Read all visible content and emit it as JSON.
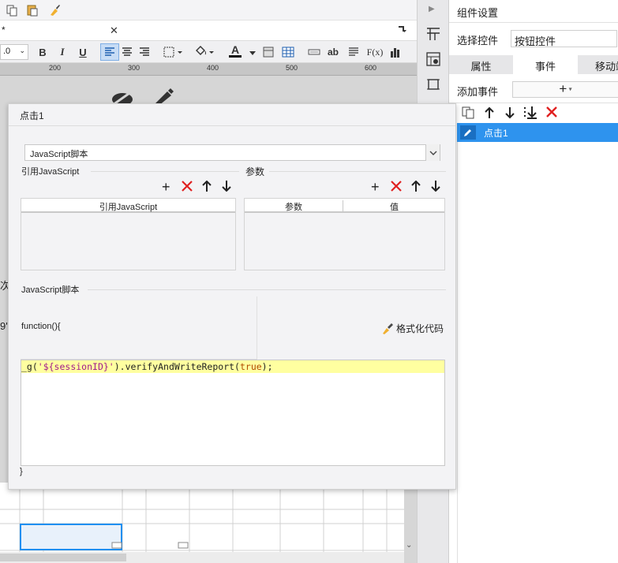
{
  "left": {
    "tab_label": "*",
    "close_glyph": "✕",
    "font_size": ".0",
    "format_buttons": {
      "bold": "B",
      "italic": "I",
      "underline": "U",
      "text_color": "A",
      "formula": "F(x)",
      "abc": "ab"
    },
    "ruler_ticks": [
      "200",
      "300",
      "400",
      "500",
      "600"
    ],
    "left_edge_glyphs": [
      "次",
      "9'"
    ]
  },
  "side_strip": {
    "collapse_glyph": "▶"
  },
  "panel": {
    "title": "组件设置",
    "select_control_label": "选择控件",
    "select_control_value": "按钮控件",
    "tabs": [
      "属性",
      "事件",
      "移动端"
    ],
    "add_event_label": "添加事件",
    "add_event_button": "+",
    "events": [
      {
        "label": "点击1",
        "selected": true
      }
    ]
  },
  "dialog": {
    "title": "点击1",
    "type_select_value": "JavaScript脚本",
    "ref_js": {
      "group_label": "引用JavaScript",
      "column_header": "引用JavaScript",
      "rows": []
    },
    "params": {
      "group_label": "参数",
      "column_headers": [
        "参数",
        "值"
      ],
      "rows": []
    },
    "script": {
      "group_label": "JavaScript脚本",
      "function_open": "function(){",
      "format_button": "格式化代码",
      "code_prefix": "_g(",
      "code_string": "'${sessionID}'",
      "code_mid": ").verifyAndWriteReport(",
      "code_keyword": "true",
      "code_suffix": ");",
      "function_close": "}"
    }
  },
  "colors": {
    "accent": "#1f8ff0",
    "delete_red": "#e02020",
    "code_highlight": "#ffffa0",
    "code_string": "#a11a8c",
    "code_keyword": "#b14a00"
  }
}
